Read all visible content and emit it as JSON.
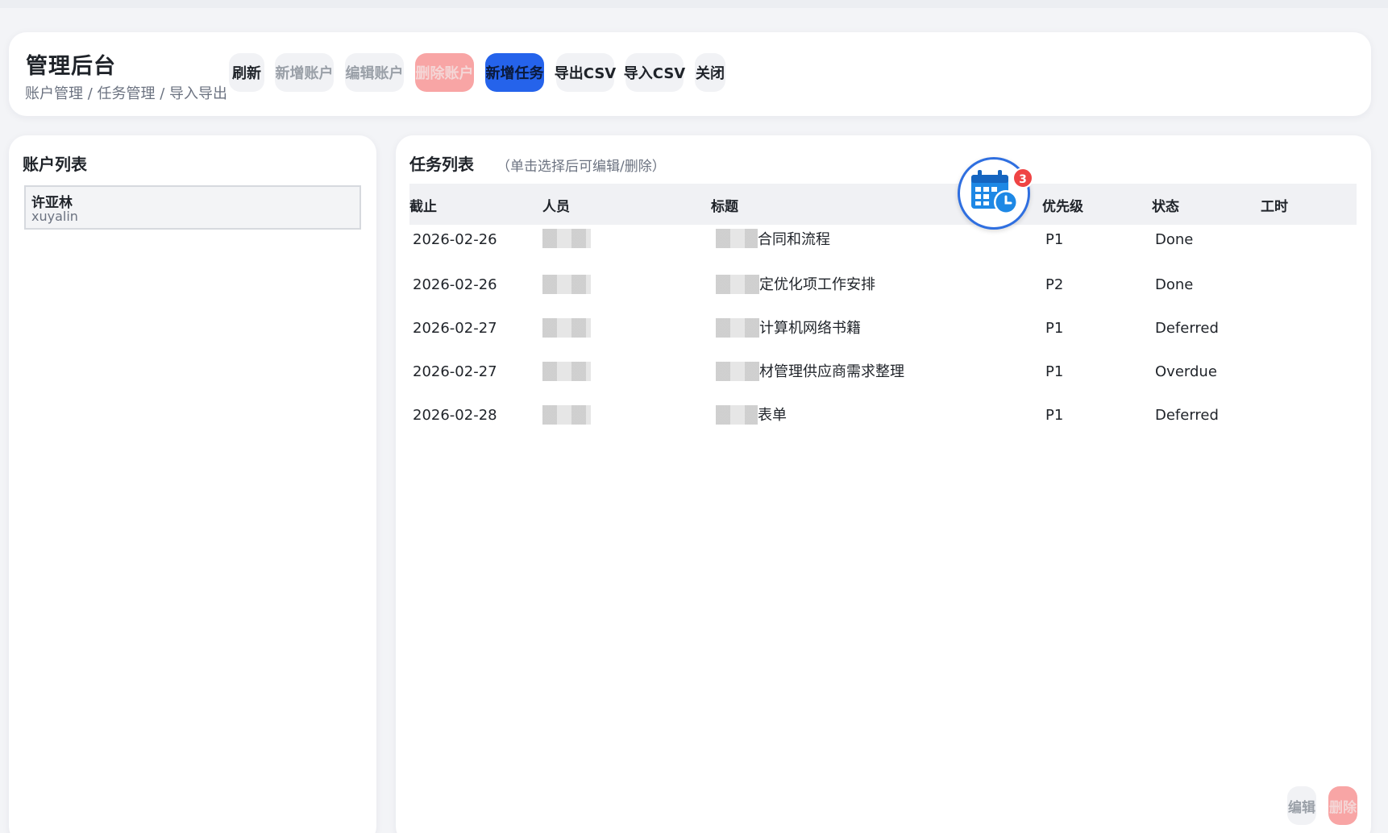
{
  "header": {
    "title": "管理后台",
    "breadcrumb": "账户管理 / 任务管理 / 导入导出",
    "toolbar": {
      "refresh": "刷新",
      "add_account": "新增账户",
      "edit_account": "编辑账户",
      "delete_account": "删除账户",
      "add_task": "新增任务",
      "export_csv": "导出CSV",
      "import_csv": "导入CSV",
      "close": "关闭"
    }
  },
  "accounts": {
    "title": "账户列表",
    "items": [
      {
        "name": "许亚林",
        "username": "xuyalin"
      }
    ]
  },
  "tasks": {
    "title": "任务列表",
    "hint": "（单击选择后可编辑/删除）",
    "columns": {
      "due": "截止",
      "person": "人员",
      "title": "标题",
      "priority": "优先级",
      "status": "状态",
      "hours": "工时"
    },
    "rows": [
      {
        "due": "2026-02-26",
        "person_suffix": "",
        "title_suffix": "合同和流程",
        "priority": "P1",
        "status": "Done",
        "hours": ""
      },
      {
        "due": "2026-02-26",
        "person_suffix": "",
        "title_suffix": "定优化项工作安排",
        "priority": "P2",
        "status": "Done",
        "hours": ""
      },
      {
        "due": "2026-02-27",
        "person_suffix": "",
        "title_suffix": "计算机网络书籍",
        "priority": "P1",
        "status": "Deferred",
        "hours": ""
      },
      {
        "due": "2026-02-27",
        "person_suffix": "",
        "title_suffix": "材管理供应商需求整理",
        "priority": "P1",
        "status": "Overdue",
        "hours": ""
      },
      {
        "due": "2026-02-28",
        "person_suffix": "",
        "title_suffix": "表单",
        "priority": "P1",
        "status": "Deferred",
        "hours": ""
      }
    ]
  },
  "floating_badge": {
    "icon": "calendar-clock-icon",
    "count": "3"
  },
  "footer": {
    "edit": "编辑",
    "delete": "删除"
  },
  "colors": {
    "primary": "#2563eb",
    "danger": "#f8a5a5",
    "badge": "#ef4444",
    "icon_blue": "#1e88e5"
  }
}
